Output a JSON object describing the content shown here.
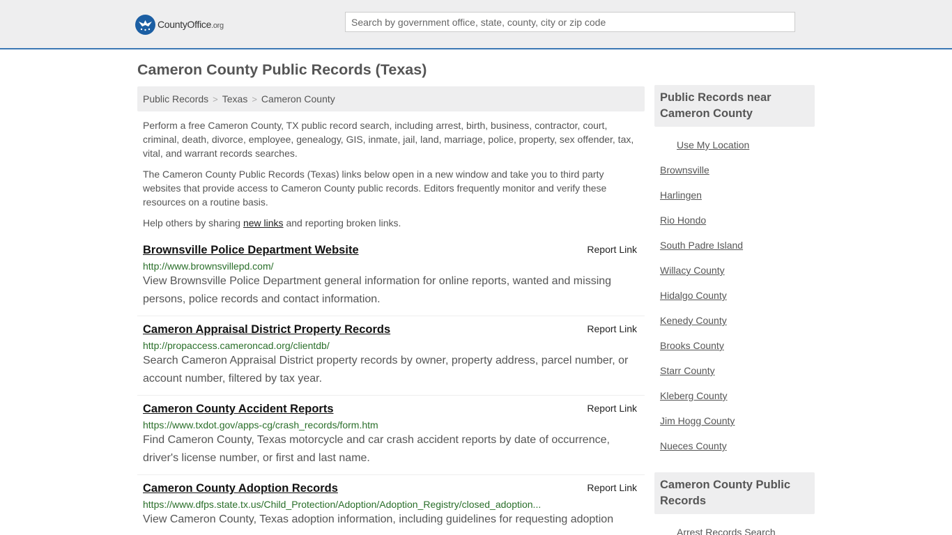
{
  "brand": {
    "name": "CountyOffice",
    "tld": ".org"
  },
  "search": {
    "placeholder": "Search by government office, state, county, city or zip code"
  },
  "page_title": "Cameron County Public Records (Texas)",
  "breadcrumb": [
    "Public Records",
    "Texas",
    "Cameron County"
  ],
  "intro": {
    "p1": "Perform a free Cameron County, TX public record search, including arrest, birth, business, contractor, court, criminal, death, divorce, employee, genealogy, GIS, inmate, jail, land, marriage, police, property, sex offender, tax, vital, and warrant records searches.",
    "p2": "The Cameron County Public Records (Texas) links below open in a new window and take you to third party websites that provide access to Cameron County public records. Editors frequently monitor and verify these resources on a routine basis.",
    "p3_before": "Help others by sharing ",
    "p3_link": "new links",
    "p3_after": " and reporting broken links."
  },
  "records": [
    {
      "title": "Brownsville Police Department Website",
      "report": "Report Link",
      "url": "http://www.brownsvillepd.com/",
      "desc": "View Brownsville Police Department general information for online reports, wanted and missing persons, police records and contact information."
    },
    {
      "title": "Cameron Appraisal District Property Records",
      "report": "Report Link",
      "url": "http://propaccess.cameroncad.org/clientdb/",
      "desc": "Search Cameron Appraisal District property records by owner, property address, parcel number, or account number, filtered by tax year."
    },
    {
      "title": "Cameron County Accident Reports",
      "report": "Report Link",
      "url": "https://www.txdot.gov/apps-cg/crash_records/form.htm",
      "desc": "Find Cameron County, Texas motorcycle and car crash accident reports by date of occurrence, driver's license number, or first and last name."
    },
    {
      "title": "Cameron County Adoption Records",
      "report": "Report Link",
      "url": "https://www.dfps.state.tx.us/Child_Protection/Adoption/Adoption_Registry/closed_adoption...",
      "desc": "View Cameron County, Texas adoption information, including guidelines for requesting adoption"
    }
  ],
  "sidebar": {
    "near_title": "Public Records near Cameron County",
    "use_location": "Use My Location",
    "near": [
      "Brownsville",
      "Harlingen",
      "Rio Hondo",
      "South Padre Island",
      "Willacy County",
      "Hidalgo County",
      "Kenedy County",
      "Brooks County",
      "Starr County",
      "Kleberg County",
      "Jim Hogg County",
      "Nueces County"
    ],
    "county_title": "Cameron County Public Records",
    "county_items": [
      "Arrest Records Search"
    ]
  },
  "colors": {
    "accent": "#3b78b4",
    "url_green": "#2a6f2a",
    "panel": "#eeeeef"
  },
  "icons": {
    "logo": "eagle-seal-icon"
  }
}
